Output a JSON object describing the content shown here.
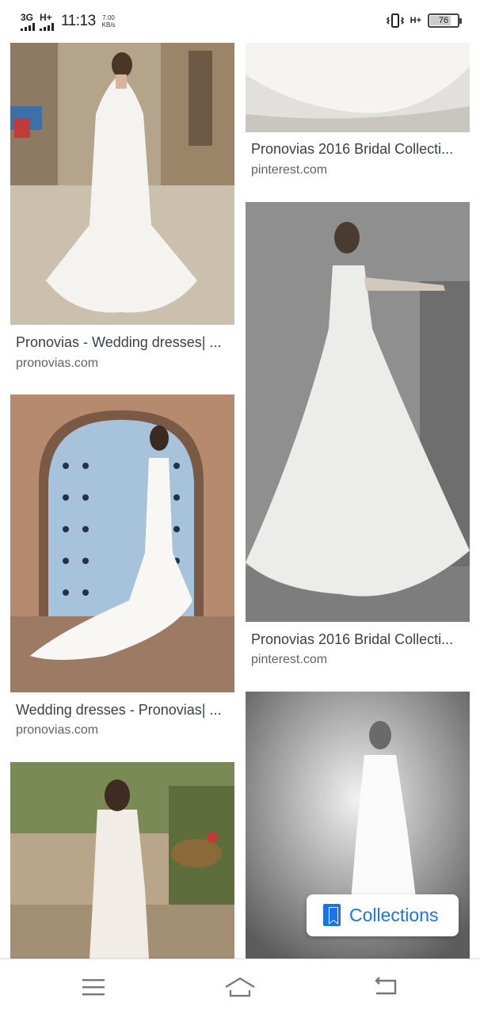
{
  "status_bar": {
    "network_1": "3G",
    "network_2": "H+",
    "time": "11:13",
    "speed_value": "7.00",
    "speed_unit": "KB/s",
    "network_right": "H+",
    "battery_level": 76,
    "battery_text": "76",
    "icons": [
      "signal-icon",
      "signal-icon",
      "vibrate-icon",
      "battery-icon"
    ]
  },
  "results": [
    {
      "title": "Pronovias - Wedding dresses| ...",
      "source": "pronovias.com"
    },
    {
      "title": "Pronovias 2016 Bridal Collecti...",
      "source": "pinterest.com"
    },
    {
      "title": "Wedding dresses - Pronovias| ...",
      "source": "pronovias.com"
    },
    {
      "title": "Pronovias 2016 Bridal Collecti...",
      "source": "pinterest.com"
    },
    {
      "title": "",
      "source": ""
    },
    {
      "title": "",
      "source": ""
    }
  ],
  "collections": {
    "label": "Collections",
    "icon": "bookmark-icon",
    "color": "#1a73e8"
  },
  "nav": {
    "icons": [
      "menu-icon",
      "home-icon",
      "back-icon"
    ]
  }
}
